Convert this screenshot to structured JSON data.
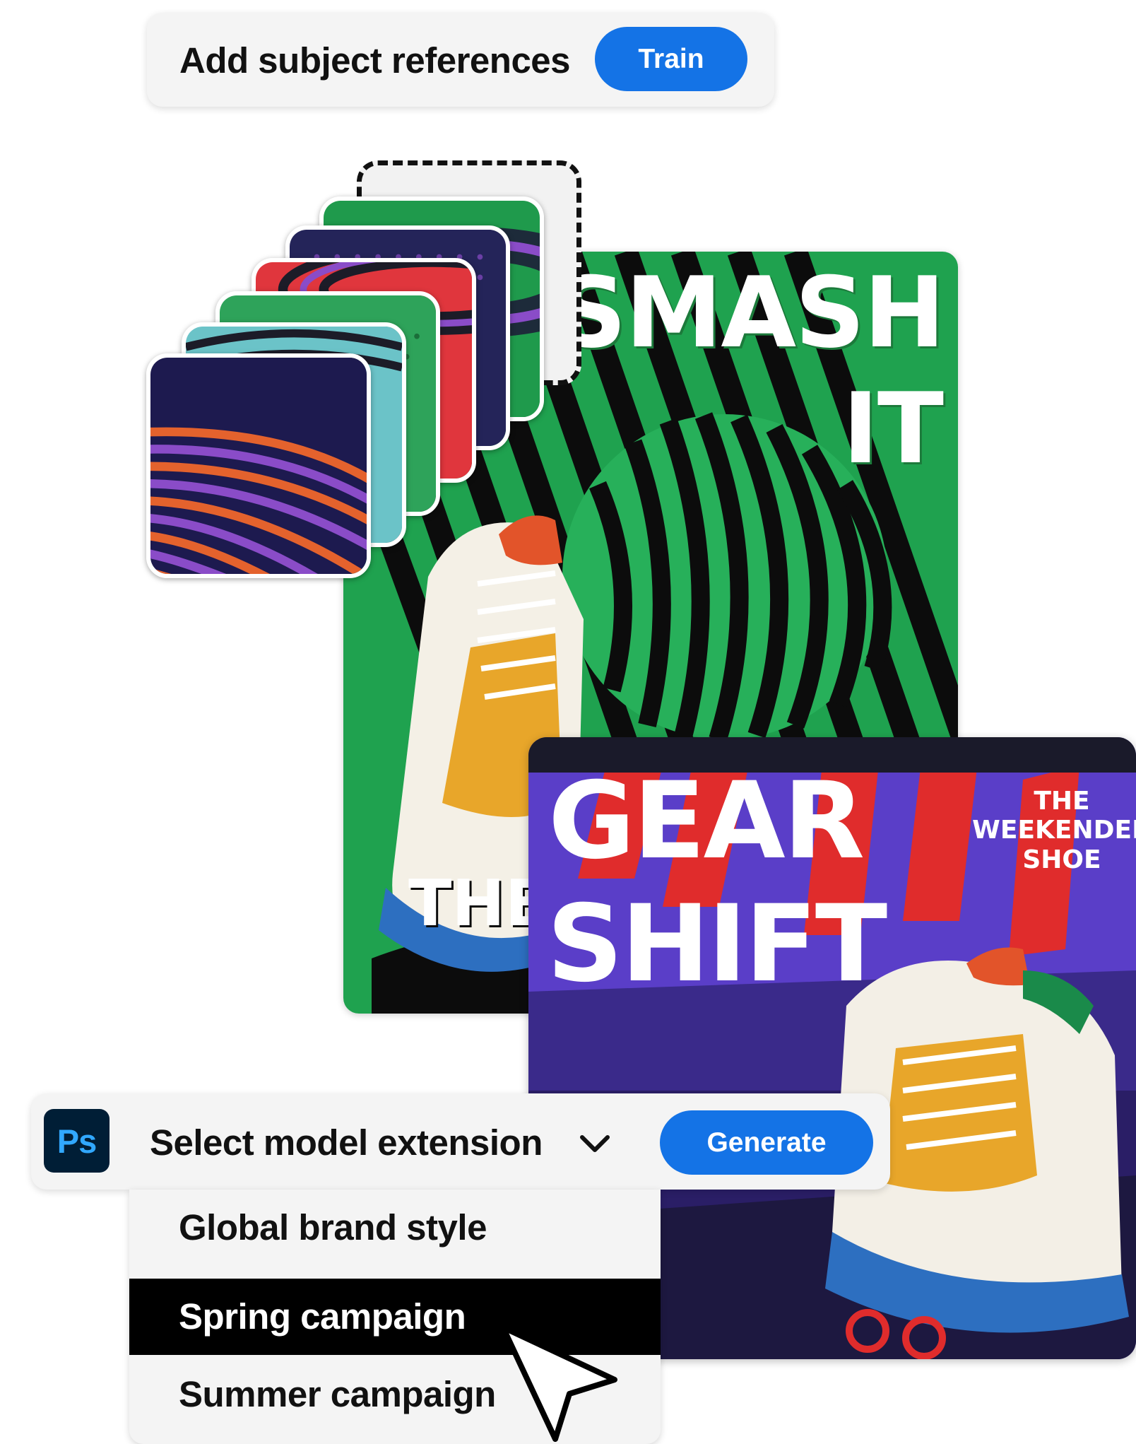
{
  "subject_bar": {
    "label": "Add subject references",
    "train_label": "Train"
  },
  "reference_cards": [
    {
      "name": "reference-card-1"
    },
    {
      "name": "reference-card-2"
    },
    {
      "name": "reference-card-3"
    },
    {
      "name": "reference-card-4"
    },
    {
      "name": "reference-card-5"
    },
    {
      "name": "reference-card-6"
    },
    {
      "name": "reference-card-empty"
    }
  ],
  "posters": {
    "green": {
      "line1": "SMASH",
      "line2": "IT",
      "line3": "THE"
    },
    "purple": {
      "line1": "GEAR",
      "line2": "SHIFT",
      "tagline": "THE WEEKENDER SHOE"
    }
  },
  "model_bar": {
    "app_icon": "Ps",
    "label": "Select model extension",
    "chevron_icon": "chevron-down-icon",
    "generate_label": "Generate"
  },
  "dropdown": {
    "options": [
      "Global brand style",
      "Spring campaign",
      "Summer campaign"
    ],
    "selected": "Spring campaign"
  },
  "colors": {
    "accent": "#1473e6",
    "ps_background": "#001e36",
    "ps_text": "#31a8ff",
    "selected_item": "#000000"
  }
}
